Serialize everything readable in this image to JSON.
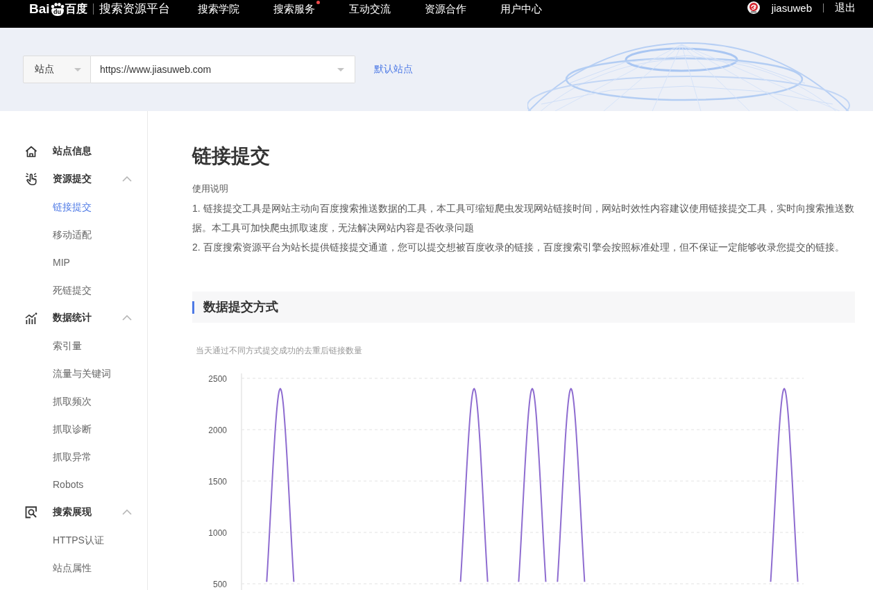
{
  "top_bar": {
    "logo": {
      "text": "Bai",
      "badge": "du",
      "name": "百度"
    },
    "platform": "搜索资源平台",
    "nav": [
      {
        "label": "搜索学院",
        "dot": false
      },
      {
        "label": "搜索服务",
        "dot": true
      },
      {
        "label": "互动交流",
        "dot": false
      },
      {
        "label": "资源合作",
        "dot": false
      },
      {
        "label": "用户中心",
        "dot": false
      }
    ],
    "user": {
      "name": "jiasuweb",
      "logout": "退出"
    }
  },
  "site_bar": {
    "type_select": {
      "value": "站点"
    },
    "site_select": {
      "value": "https://www.jiasuweb.com"
    },
    "default_link": "默认站点"
  },
  "sidebar": {
    "groups": [
      {
        "kind": "item",
        "label": "站点信息"
      },
      {
        "kind": "group",
        "label": "资源提交",
        "expanded": true,
        "children": [
          {
            "label": "链接提交",
            "selected": true
          },
          {
            "label": "移动适配",
            "selected": false
          },
          {
            "label": "MIP",
            "selected": false
          },
          {
            "label": "死链提交",
            "selected": false
          }
        ]
      },
      {
        "kind": "group",
        "label": "数据统计",
        "expanded": true,
        "children": [
          {
            "label": "索引量",
            "selected": false
          },
          {
            "label": "流量与关键词",
            "selected": false
          },
          {
            "label": "抓取频次",
            "selected": false
          },
          {
            "label": "抓取诊断",
            "selected": false
          },
          {
            "label": "抓取异常",
            "selected": false
          },
          {
            "label": "Robots",
            "selected": false
          }
        ]
      },
      {
        "kind": "group",
        "label": "搜索展现",
        "expanded": true,
        "children": [
          {
            "label": "HTTPS认证",
            "selected": false
          },
          {
            "label": "站点属性",
            "selected": false
          }
        ]
      }
    ]
  },
  "main": {
    "title": "链接提交",
    "intro": {
      "heading": "使用说明",
      "items": [
        "1. 链接提交工具是网站主动向百度搜索推送数据的工具，本工具可缩短爬虫发现网站链接时间，网站时效性内容建议使用链接提交工具，实时向搜索推送数据。本工具可加快爬虫抓取速度，无法解决网站内容是否收录问题",
        "2. 百度搜索资源平台为站长提供链接提交通道，您可以提交想被百度收录的链接，百度搜索引擎会按照标准处理，但不保证一定能够收录您提交的链接。"
      ]
    },
    "section": {
      "title": "数据提交方式",
      "caption": "当天通过不同方式提交成功的去重后链接数量",
      "y_axis_labels": [
        "2500",
        "2000",
        "1500",
        "1000",
        "500"
      ]
    }
  }
}
